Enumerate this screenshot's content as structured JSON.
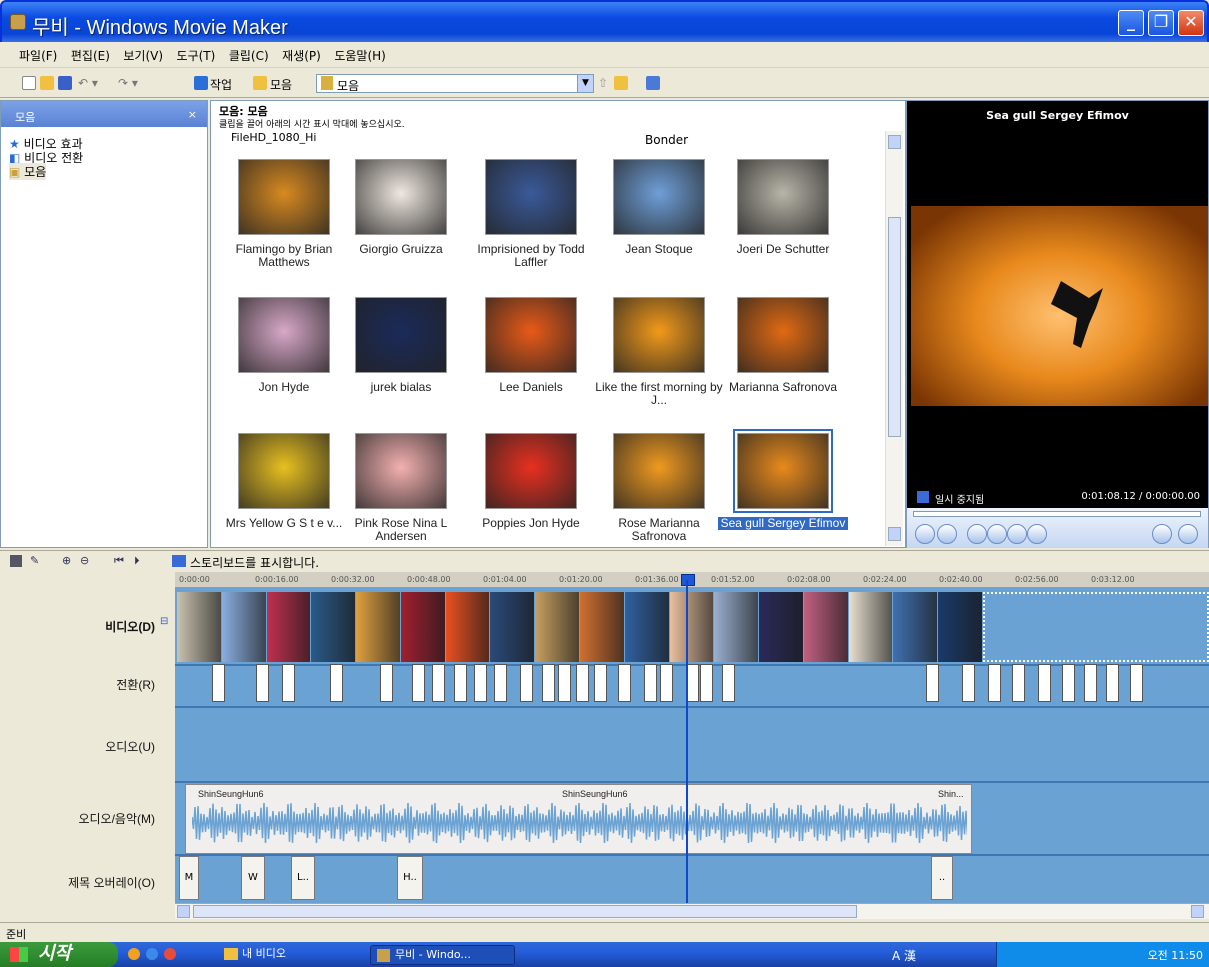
{
  "window": {
    "title": "무비 - Windows Movie Maker",
    "minimize_glyph": "_",
    "restore_glyph": "❐",
    "close_glyph": "✕"
  },
  "menu": [
    "파일(F)",
    "편집(E)",
    "보기(V)",
    "도구(T)",
    "클립(C)",
    "재생(P)",
    "도움말(H)"
  ],
  "toolbar": {
    "tasks_label": "작업",
    "collections_label": "모음",
    "combo_value": "모음"
  },
  "left_pane": {
    "header": "모음",
    "items": [
      "비디오 효과",
      "비디오 전환",
      "모음"
    ]
  },
  "content": {
    "header": "모음: 모음",
    "instruction": "클립을 끌어 아래의 시간 표시 막대에 놓으십시오.",
    "top_partial_left": "FileHD_1080_Hi",
    "top_partial_right": "Bonder",
    "tiles": [
      {
        "caption": "Flamingo by Brian Matthews",
        "color": "#d88a20"
      },
      {
        "caption": "Giorgio Gruizza",
        "color": "#f0e8e0"
      },
      {
        "caption": "Imprisioned by Todd Laffler",
        "color": "#3a5a9a"
      },
      {
        "caption": "Jean Stoque",
        "color": "#6f9fd8"
      },
      {
        "caption": "Joeri De Schutter",
        "color": "#b8b4a8"
      },
      {
        "caption": "Jon Hyde",
        "color": "#d8a8c8"
      },
      {
        "caption": "jurek bialas",
        "color": "#1a2a5a"
      },
      {
        "caption": "Lee Daniels",
        "color": "#e85a18"
      },
      {
        "caption": "Like the first morning by J...",
        "color": "#f29a1a"
      },
      {
        "caption": "Marianna Safronova",
        "color": "#e06a12"
      },
      {
        "caption": "Mrs Yellow G S t e v...",
        "color": "#e8c020"
      },
      {
        "caption": "Pink Rose Nina L Andersen",
        "color": "#f4b0b0"
      },
      {
        "caption": "Poppies Jon Hyde",
        "color": "#e83020"
      },
      {
        "caption": "Rose Marianna Safronova",
        "color": "#f09a20"
      },
      {
        "caption": "Sea gull Sergey Efimov",
        "color": "#e88a1c",
        "selected": true
      }
    ]
  },
  "preview": {
    "title": "Sea gull Sergey Efimov",
    "status": "일시 중지됨",
    "time": "0:01:08.12 / 0:00:00.00"
  },
  "timeline": {
    "toolbar_label": "스토리보드를 표시합니다.",
    "ticks": [
      "0:00:00",
      "0:00:16.00",
      "0:00:32.00",
      "0:00:48.00",
      "0:01:04.00",
      "0:01:20.00",
      "0:01:36.00",
      "0:01:52.00",
      "0:02:08.00",
      "0:02:24.00",
      "0:02:40.00",
      "0:02:56.00",
      "0:03:12.00"
    ],
    "tracks": [
      "비디오(D)",
      "전환(R)",
      "오디오(U)",
      "오디오/음악(M)",
      "제목 오버레이(O)"
    ],
    "audio_labels": [
      "ShinSeungHun6",
      "ShinSeungHun6",
      "Shin..."
    ],
    "title_clips": [
      "M",
      "W",
      "L..",
      "H..",
      ".."
    ],
    "video_clip_colors": [
      "#c9c2b0",
      "#8aaee0",
      "#c03050",
      "#2a5a8a",
      "#e0a040",
      "#a02030",
      "#e85020",
      "#2a4a7a",
      "#c8a060",
      "#d07030",
      "#3060a0",
      "#e8c0a0",
      "#9ab0d0",
      "#2a2a5a",
      "#c06080",
      "#e8e0d0",
      "#4070b0",
      "#1a3a6a"
    ]
  },
  "status": "준비",
  "taskbar": {
    "start": "시작",
    "folder": "내 비디오",
    "active_task": "무비 - Windo...",
    "clock": "오전 11:50",
    "ime": "A 漢"
  }
}
